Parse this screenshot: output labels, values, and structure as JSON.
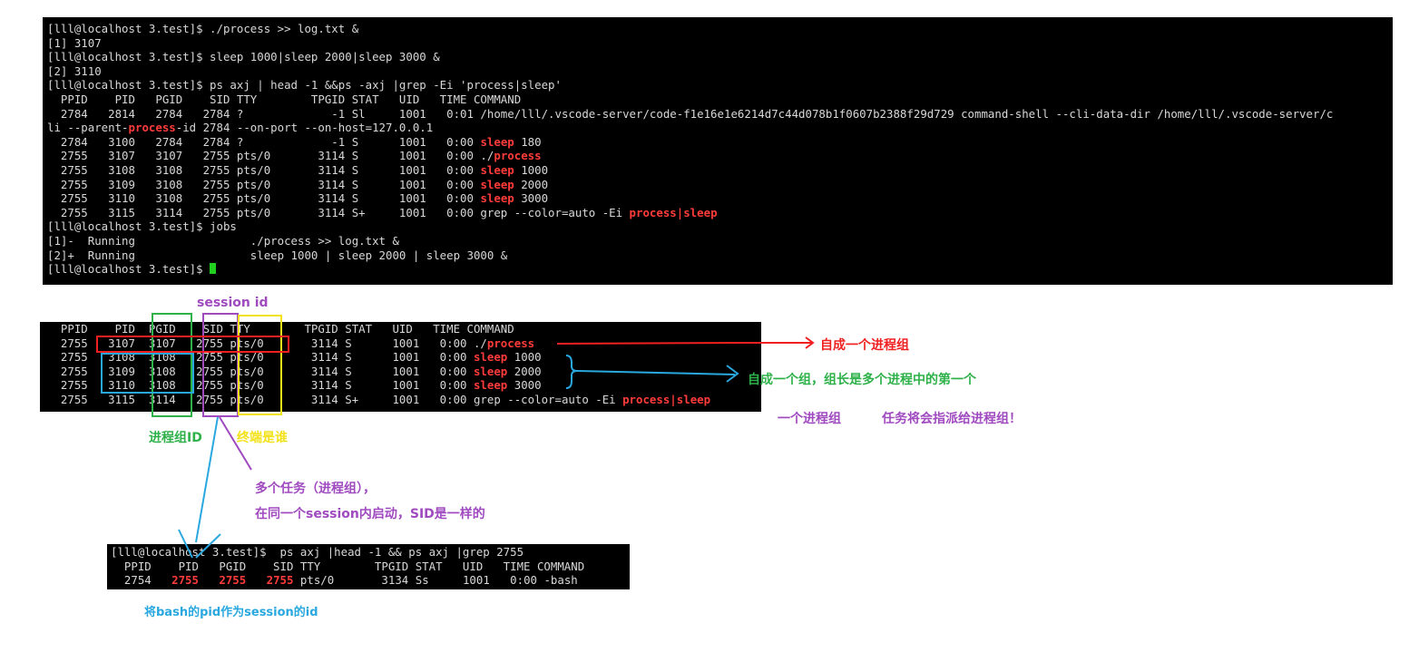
{
  "terminal1": {
    "lines": [
      "[lll@localhost 3.test]$ ./process >> log.txt &",
      "[1] 3107",
      "[lll@localhost 3.test]$ sleep 1000|sleep 2000|sleep 3000 &",
      "[2] 3110",
      "[lll@localhost 3.test]$ ps axj | head -1 &&ps -axj |grep -Ei 'process|sleep'",
      "  PPID    PID   PGID    SID TTY        TPGID STAT   UID   TIME COMMAND",
      "  2784   2814   2784   2784 ?             -1 Sl     1001   0:01 /home/lll/.vscode-server/code-f1e16e1e6214d7c44d078b1f0607b2388f29d729 command-shell --cli-data-dir /home/lll/.vscode-server/c",
      [
        "li --parent-",
        "process",
        "-id 2784 --on-port --on-host=127.0.0.1"
      ],
      [
        "  2784   3100   2784   2784 ?             -1 S      1001   0:00 ",
        "sleep",
        " 180"
      ],
      [
        "  2755   3107   3107   2755 pts/0       3114 S      1001   0:00 ./",
        "process",
        ""
      ],
      [
        "  2755   3108   3108   2755 pts/0       3114 S      1001   0:00 ",
        "sleep",
        " 1000"
      ],
      [
        "  2755   3109   3108   2755 pts/0       3114 S      1001   0:00 ",
        "sleep",
        " 2000"
      ],
      [
        "  2755   3110   3108   2755 pts/0       3114 S      1001   0:00 ",
        "sleep",
        " 3000"
      ],
      [
        "  2755   3115   3114   2755 pts/0       3114 S+     1001   0:00 grep --color=auto -Ei ",
        "process|sleep",
        ""
      ],
      "[lll@localhost 3.test]$ jobs",
      "[1]-  Running                 ./process >> log.txt &",
      "[2]+  Running                 sleep 1000 | sleep 2000 | sleep 3000 &",
      "[lll@localhost 3.test]$ "
    ]
  },
  "terminal2": {
    "lines": [
      "  PPID    PID  PGID    SID TTY        TPGID STAT   UID   TIME COMMAND",
      [
        "  2755   3107  3107   2755 pts/0       3114 S      1001   0:00 ./",
        "process",
        ""
      ],
      [
        "  2755   3108  3108   2755 pts/0       3114 S      1001   0:00 ",
        "sleep",
        " 1000"
      ],
      [
        "  2755   3109  3108   2755 pts/0       3114 S      1001   0:00 ",
        "sleep",
        " 2000"
      ],
      [
        "  2755   3110  3108   2755 pts/0       3114 S      1001   0:00 ",
        "sleep",
        " 3000"
      ],
      [
        "  2755   3115  3114   2755 pts/0       3114 S+     1001   0:00 grep --color=auto -Ei ",
        "process|sleep",
        ""
      ]
    ]
  },
  "terminal3": {
    "lines": [
      "[lll@localhost 3.test]$  ps axj |head -1 && ps axj |grep 2755",
      "  PPID    PID   PGID    SID TTY        TPGID STAT   UID   TIME COMMAND",
      [
        "  2754   ",
        "2755",
        "   ",
        "2755",
        "   ",
        "2755",
        " pts/0       3134 Ss     1001   0:00 -bash"
      ]
    ]
  },
  "annotations": {
    "session_id": "session id",
    "pgid_label": "进程组ID",
    "tty_label": "终端是谁",
    "self_group": "自成一个进程组",
    "group_leader": "自成一个组，组长是多个进程中的第一个",
    "one_group": "一个进程组",
    "task_assign": "任务将会指派给进程组！",
    "multi_task": "多个任务（进程组），",
    "same_session": "在同一个session内启动，SID是一样的",
    "bash_pid": "将bash的pid作为session的id"
  },
  "colors": {
    "red": "#f02020",
    "green": "#2fb14a",
    "purple": "#a04ac0",
    "yellow": "#f3e21a",
    "blue": "#29a8e0"
  }
}
